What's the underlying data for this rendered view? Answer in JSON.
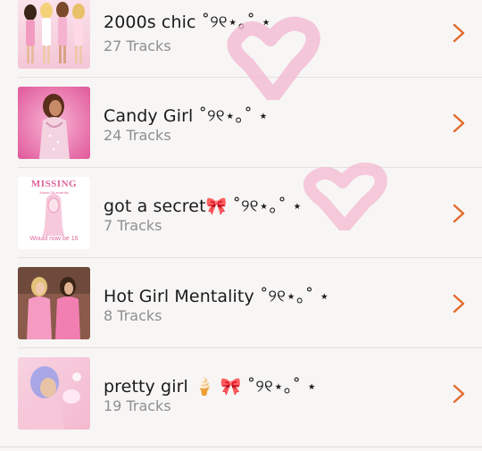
{
  "colors": {
    "accent": "#e46a2c",
    "background": "#f7f6f5",
    "heart": "#f3b5cf"
  },
  "playlists": [
    {
      "title": "2000s chic ˚୨୧⋆｡˚ ⋆",
      "tracks": "27 Tracks",
      "artwork": "dolls-artwork"
    },
    {
      "title": "Candy Girl ˚୨୧⋆｡˚ ⋆",
      "tracks": "24 Tracks",
      "artwork": "pink-portrait-artwork"
    },
    {
      "title": "got a secret🎀 ˚୨୧⋆｡˚ ⋆",
      "tracks": "7 Tracks",
      "artwork": "missing-poster-artwork",
      "poster": {
        "headline": "MISSING",
        "name": "Alison DiLaurentis",
        "footer": "Would now be 16"
      }
    },
    {
      "title": "Hot Girl Mentality ˚୨୧⋆｡˚ ⋆",
      "tracks": "8 Tracks",
      "artwork": "two-girls-artwork"
    },
    {
      "title": "pretty girl 🍦 🎀 ˚୨୧⋆｡˚ ⋆",
      "tracks": "19 Tracks",
      "artwork": "blue-hair-artwork"
    }
  ],
  "icons": {
    "disclosure": "chevron-right-icon"
  }
}
